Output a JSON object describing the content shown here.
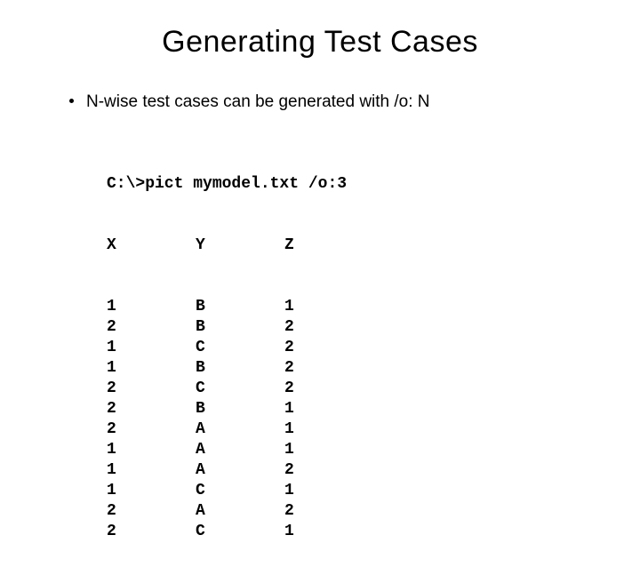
{
  "title": "Generating Test Cases",
  "bullet": "N-wise test cases can be generated with /o: N",
  "code": {
    "cmd": "C:\\>pict mymodel.txt /o:3",
    "headers": [
      "X",
      "Y",
      "Z"
    ],
    "rows": [
      [
        "1",
        "B",
        "1"
      ],
      [
        "2",
        "B",
        "2"
      ],
      [
        "1",
        "C",
        "2"
      ],
      [
        "1",
        "B",
        "2"
      ],
      [
        "2",
        "C",
        "2"
      ],
      [
        "2",
        "B",
        "1"
      ],
      [
        "2",
        "A",
        "1"
      ],
      [
        "1",
        "A",
        "1"
      ],
      [
        "1",
        "A",
        "2"
      ],
      [
        "1",
        "C",
        "1"
      ],
      [
        "2",
        "A",
        "2"
      ],
      [
        "2",
        "C",
        "1"
      ]
    ]
  }
}
